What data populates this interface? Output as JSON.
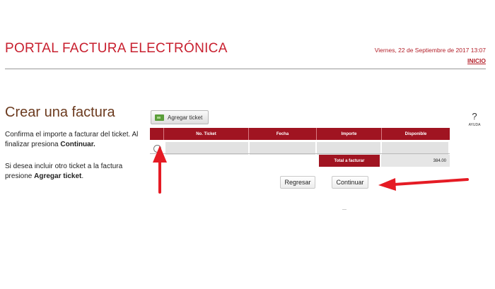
{
  "header": {
    "title": "PORTAL FACTURA ELECTRÓNICA",
    "datetime": "Viernes, 22 de Septiembre de 2017   13:07",
    "home_link": "INICIO"
  },
  "main": {
    "title": "Crear una factura",
    "instructions": {
      "line1_text": "Confirma el importe a facturar del ticket. Al finalizar presiona ",
      "line1_bold": "Continuar.",
      "line2_text": "Si desea incluir otro ticket a la factura presione ",
      "line2_bold": "Agregar ticket",
      "line2_end": "."
    }
  },
  "toolbar": {
    "add_ticket_label": "Agregar ticket",
    "help_symbol": "?",
    "help_label": "AYUDA"
  },
  "table": {
    "columns": [
      "",
      "No. Ticket",
      "Fecha",
      "Importe",
      "Disponible"
    ],
    "total_label": "Total a facturar",
    "total_value": "384.00"
  },
  "actions": {
    "back_label": "Regresar",
    "continue_label": "Continuar"
  },
  "colors": {
    "accent": "#a01421",
    "title_red": "#c8202f",
    "arrow_red": "#e51b24"
  },
  "icons": {
    "add_ticket": "ticket-icon",
    "help": "question-mark-icon"
  }
}
